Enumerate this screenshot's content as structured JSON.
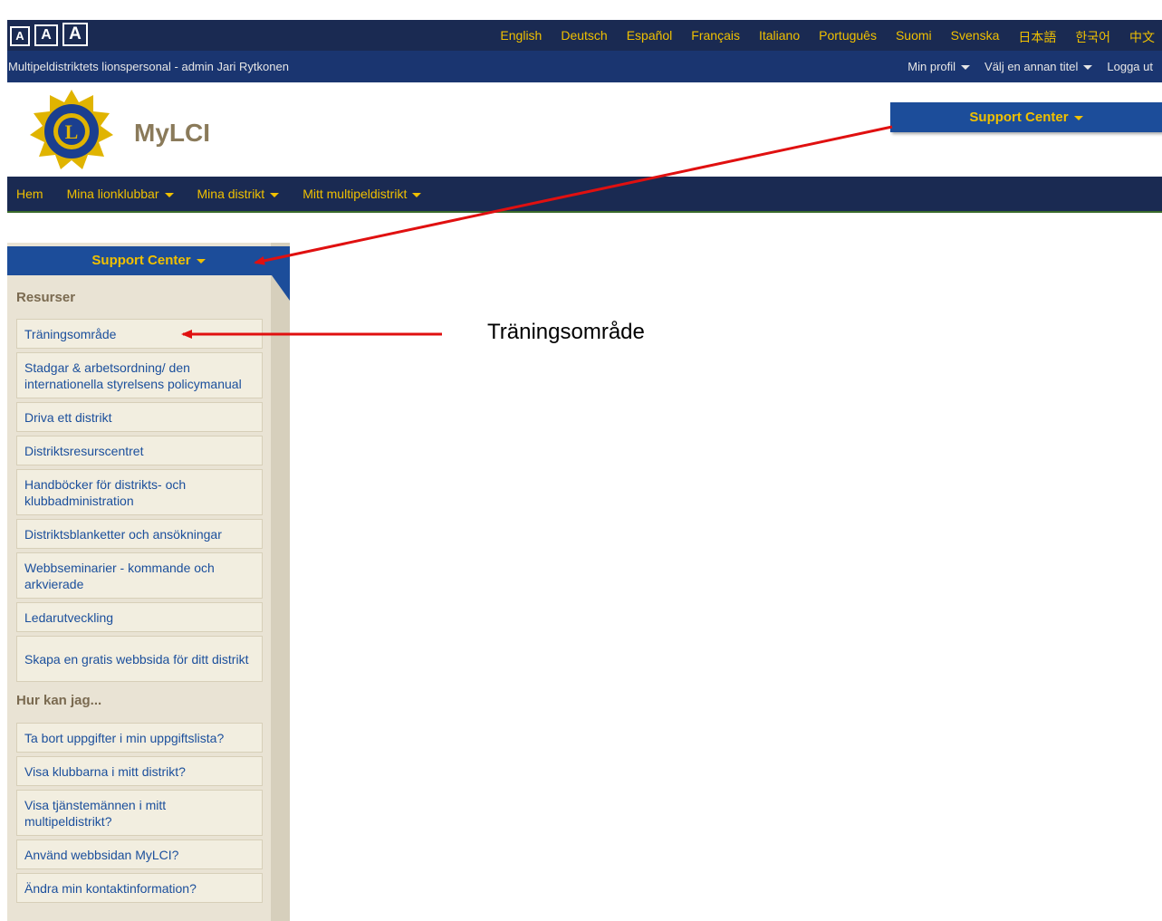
{
  "fontsize_buttons": [
    "A",
    "A",
    "A"
  ],
  "languages": [
    "English",
    "Deutsch",
    "Español",
    "Français",
    "Italiano",
    "Português",
    "Suomi",
    "Svenska",
    "日本語",
    "한국어",
    "中文"
  ],
  "userbar": {
    "who": "Multipeldistriktets lionspersonal - admin Jari Rytkonen",
    "profile": "Min profil",
    "choose_title": "Välj en annan titel",
    "logout": "Logga ut"
  },
  "brand": "MyLCI",
  "support_center_top": "Support Center",
  "nav": [
    "Hem",
    "Mina lionklubbar",
    "Mina distrikt",
    "Mitt multipeldistrikt"
  ],
  "sidebar": {
    "header": "Support Center",
    "sections": [
      {
        "title": "Resurser",
        "items": [
          "Träningsområde",
          "Stadgar & arbetsordning/ den internationella styrelsens policymanual",
          "Driva ett distrikt",
          "Distriktsresurscentret",
          "Handböcker för distrikts- och klubbadministration",
          "Distriktsblanketter och ansökningar",
          "Webbseminarier - kommande och arkvierade",
          "Ledarutveckling",
          "Skapa en gratis webbsida för ditt distrikt"
        ]
      },
      {
        "title": "Hur kan jag...",
        "items": [
          "Ta bort uppgifter i min uppgiftslista?",
          "Visa klubbarna i mitt distrikt?",
          "Visa tjänstemännen i mitt multipeldistrikt?",
          "Använd webbsidan MyLCI?",
          "Ändra min kontaktinformation?"
        ]
      }
    ]
  },
  "annotation": "Träningsområde",
  "colors": {
    "topbar": "#1a2a52",
    "userbar": "#1a3570",
    "accent_blue": "#1c4d9a",
    "gold": "#f0c000",
    "sidebar_bg": "#e9e3d4",
    "arrow_red": "#e01010"
  }
}
